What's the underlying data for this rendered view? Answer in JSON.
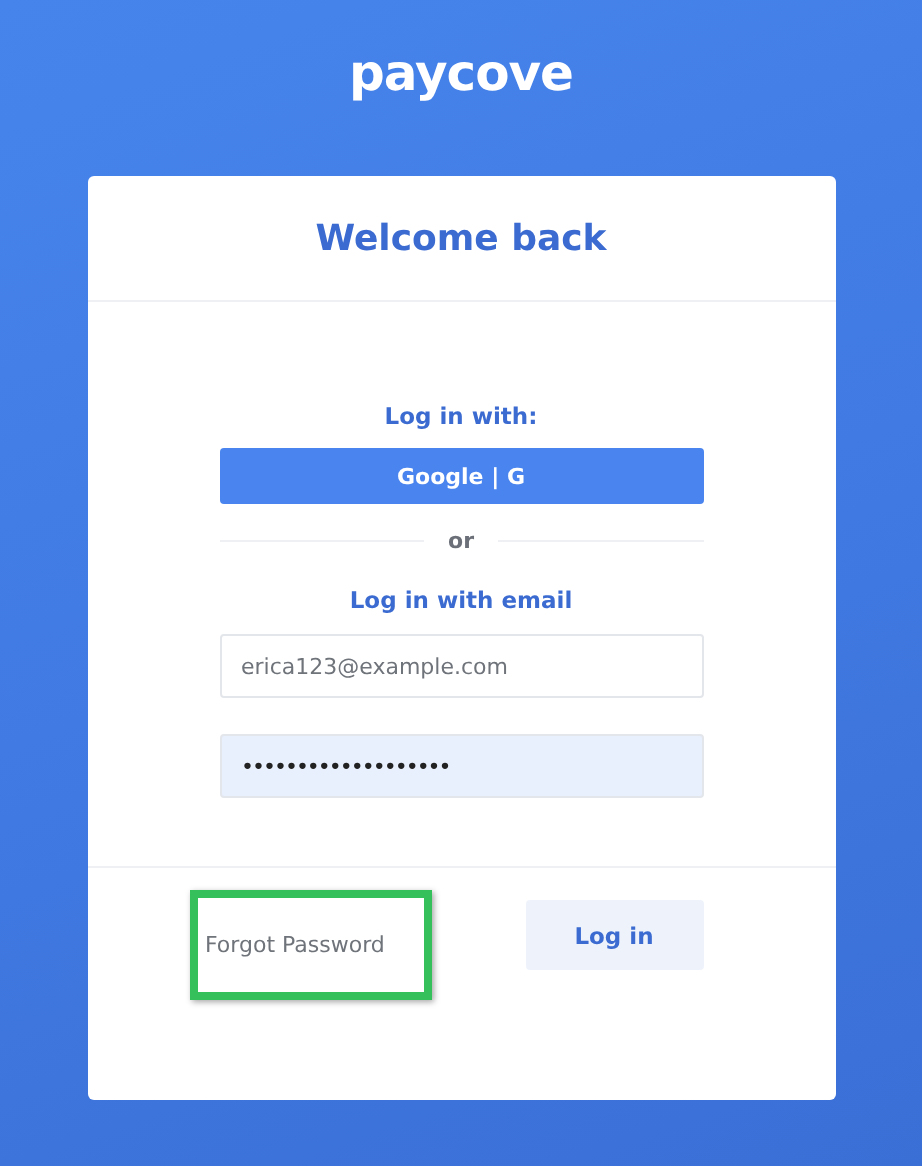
{
  "logo": "paycove",
  "card": {
    "title": "Welcome back",
    "social_heading": "Log in with:",
    "social_button": {
      "label": "Google | G"
    },
    "separator": "or",
    "email_heading": "Log in with email",
    "email_field": {
      "value": "erica123@example.com"
    },
    "password_field": {
      "value": "•••••••••••••••••••",
      "autofilled": true
    },
    "forgot_link": {
      "label": "Forgot Password",
      "highlighted": true
    },
    "login_button": {
      "label": "Log in"
    }
  }
}
